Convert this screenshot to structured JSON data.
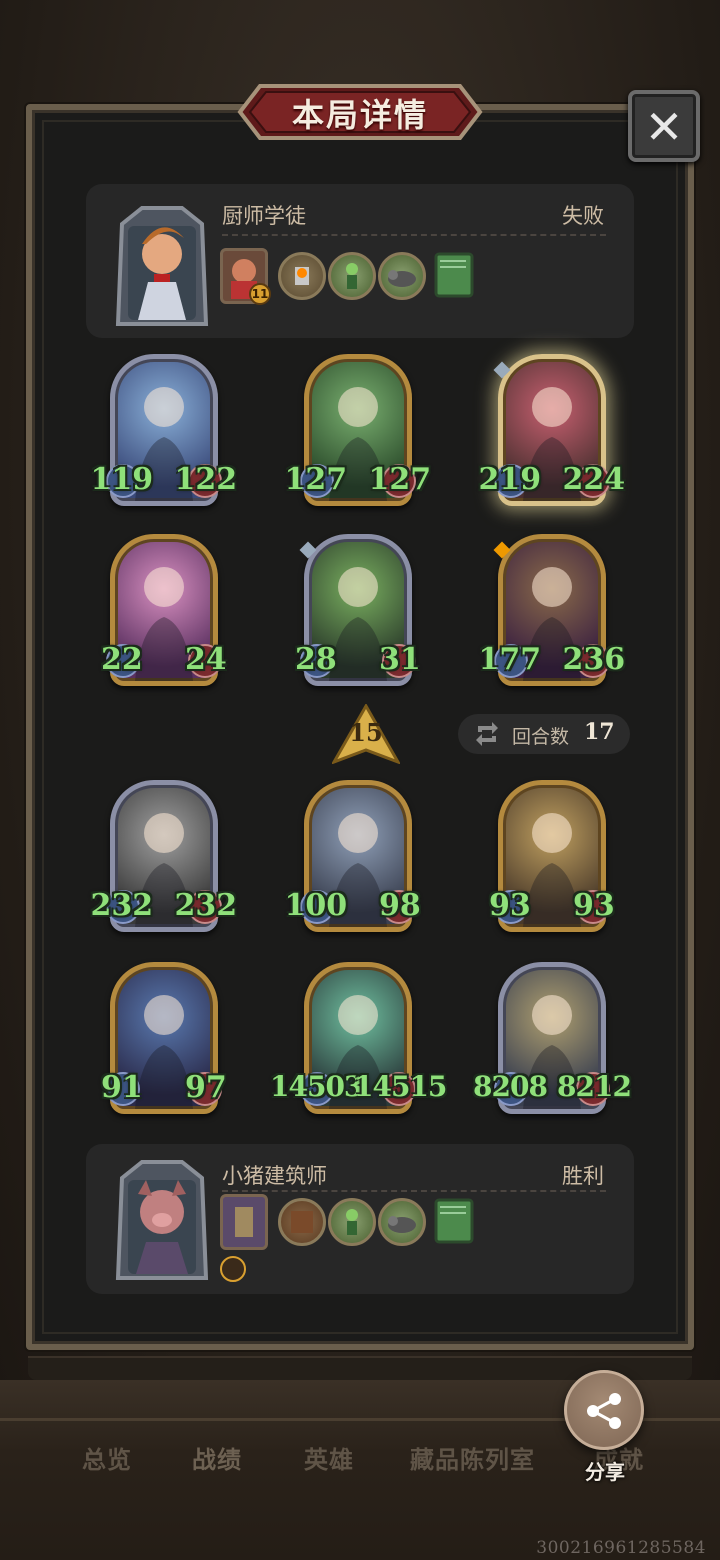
{
  "title": "本局详情",
  "close_label": "✕",
  "top_player": {
    "name": "厨师学徒",
    "result": "失败",
    "hero_level": "11"
  },
  "bottom_player": {
    "name": "小猪建筑师",
    "result": "胜利"
  },
  "rank": "15",
  "rounds": {
    "label": "回合数",
    "value": "17"
  },
  "top_units": [
    {
      "atk": "119",
      "hp": "122"
    },
    {
      "atk": "127",
      "hp": "127"
    },
    {
      "atk": "219",
      "hp": "224"
    },
    {
      "atk": "22",
      "hp": "24"
    },
    {
      "atk": "28",
      "hp": "31"
    },
    {
      "atk": "177",
      "hp": "236"
    }
  ],
  "bottom_units": [
    {
      "atk": "232",
      "hp": "232"
    },
    {
      "atk": "100",
      "hp": "98"
    },
    {
      "atk": "93",
      "hp": "93"
    },
    {
      "atk": "91",
      "hp": "97"
    },
    {
      "atk": "14503",
      "hp": "14515"
    },
    {
      "atk": "8208",
      "hp": "8212"
    }
  ],
  "share_label": "分享",
  "tabs": [
    "总览",
    "战绩",
    "英雄",
    "藏品陈列室",
    "成就"
  ],
  "watermark": "300216961285584",
  "colors": {
    "stat_green": "#8fe07a",
    "gold_frame": "#b48a3e",
    "silver_frame": "#8b8fa6"
  }
}
